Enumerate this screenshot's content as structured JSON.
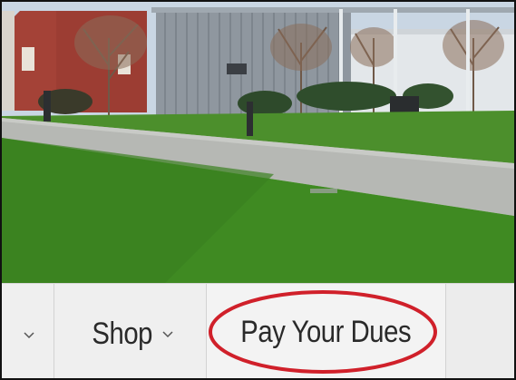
{
  "nav": {
    "items": [
      {
        "label": "",
        "icon": "chevron-down-icon"
      },
      {
        "label": "Shop",
        "icon": "chevron-down-icon"
      },
      {
        "label": "Pay Your Dues",
        "icon": ""
      }
    ]
  },
  "colors": {
    "highlight": "#d0202a",
    "nav_background": "#efefef",
    "nav_text": "#2a2a2a"
  }
}
